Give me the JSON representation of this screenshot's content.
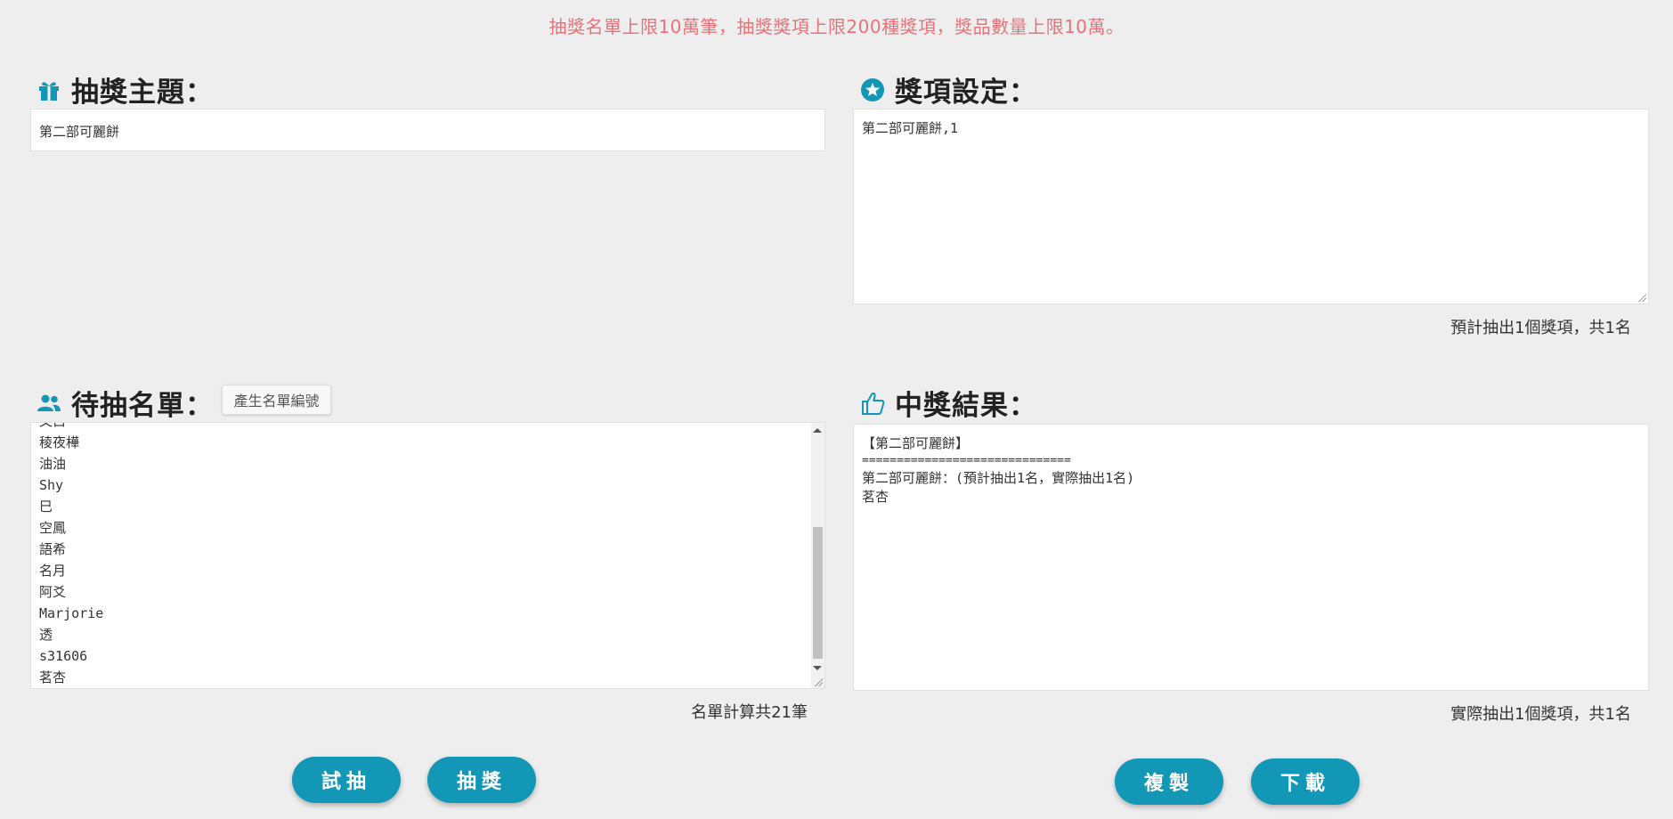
{
  "notice": "抽獎名單上限10萬筆，抽獎獎項上限200種獎項，獎品數量上限10萬。",
  "theme": {
    "heading": "抽獎主題：",
    "icon": "gift-icon",
    "value": "第二部可麗餅"
  },
  "prizes": {
    "heading": "獎項設定：",
    "icon": "star-icon",
    "value": "第二部可麗餅,1",
    "summary": "預計抽出1個獎項，共1名"
  },
  "candidates": {
    "heading": "待抽名單：",
    "icon": "users-icon",
    "generate_button": "產生名單編號",
    "partial_top": "文白",
    "items": [
      "稜夜樺",
      "油油",
      "Shy",
      "巳",
      "空鳳",
      "語希",
      "名月",
      "阿爻",
      "Marjorie",
      "透",
      "s31606",
      "茗杏"
    ],
    "summary": "名單計算共21筆"
  },
  "results": {
    "heading": "中獎結果：",
    "icon": "thumbs-up-icon",
    "lines": [
      "【第二部可麗餅】",
      "==============================",
      "第二部可麗餅：(預計抽出1名，實際抽出1名)",
      "茗杏"
    ],
    "summary": "實際抽出1個獎項，共1名"
  },
  "buttons": {
    "trial": "試抽",
    "draw": "抽獎",
    "copy": "複製",
    "download": "下載"
  },
  "colors": {
    "accent": "#1397b6",
    "notice": "#e8727a",
    "background": "#eeeeee"
  }
}
